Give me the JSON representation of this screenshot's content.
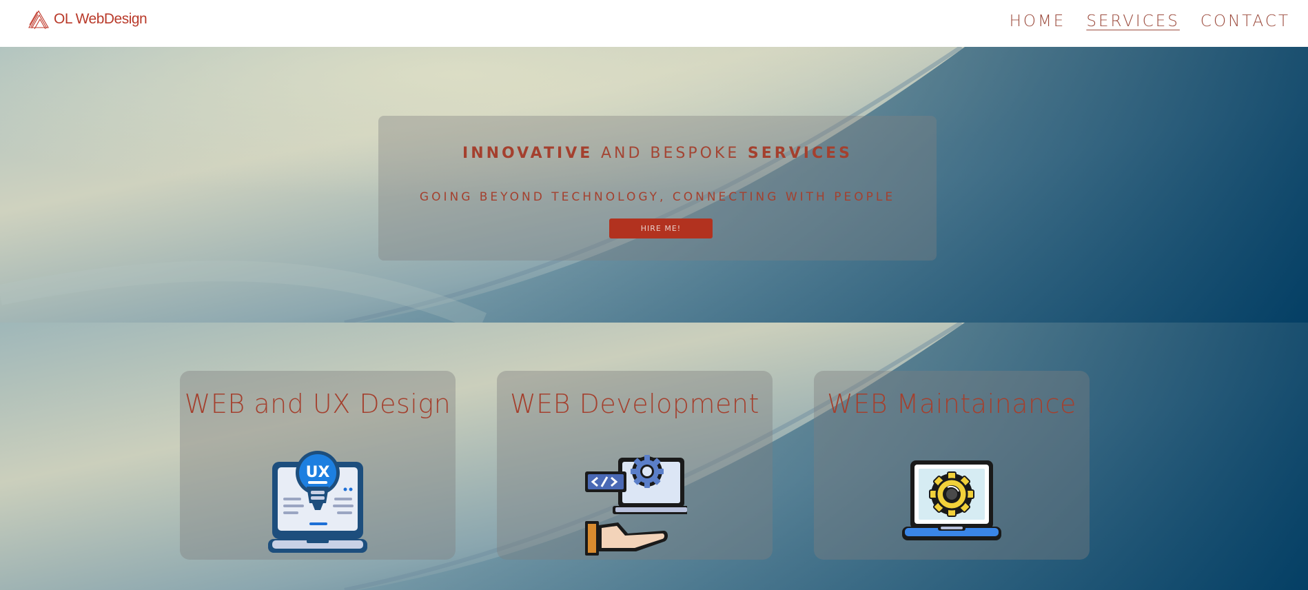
{
  "header": {
    "logo_text": "OL WebDesign",
    "nav": [
      {
        "label": "HOME",
        "active": false
      },
      {
        "label": "SERVICES",
        "active": true
      },
      {
        "label": "CONTACT",
        "active": false
      }
    ]
  },
  "hero": {
    "title_strong_1": "INNOVATIVE",
    "title_light": "AND BESPOKE",
    "title_strong_2": "SERVICES",
    "subtitle": "GOING BEYOND TECHNOLOGY, CONNECTING WITH PEOPLE",
    "button_label": "HIRE ME!"
  },
  "services": [
    {
      "title": "WEB and UX Design",
      "icon": "ux-laptop-bulb-icon",
      "icon_text": "UX"
    },
    {
      "title": "WEB Development",
      "icon": "dev-laptop-gear-hand-icon"
    },
    {
      "title": "WEB Maintainance",
      "icon": "maintenance-laptop-gear-icon"
    }
  ],
  "colors": {
    "accent": "#a4402e",
    "button": "#b2321f",
    "header_bg": "#ffffff"
  }
}
